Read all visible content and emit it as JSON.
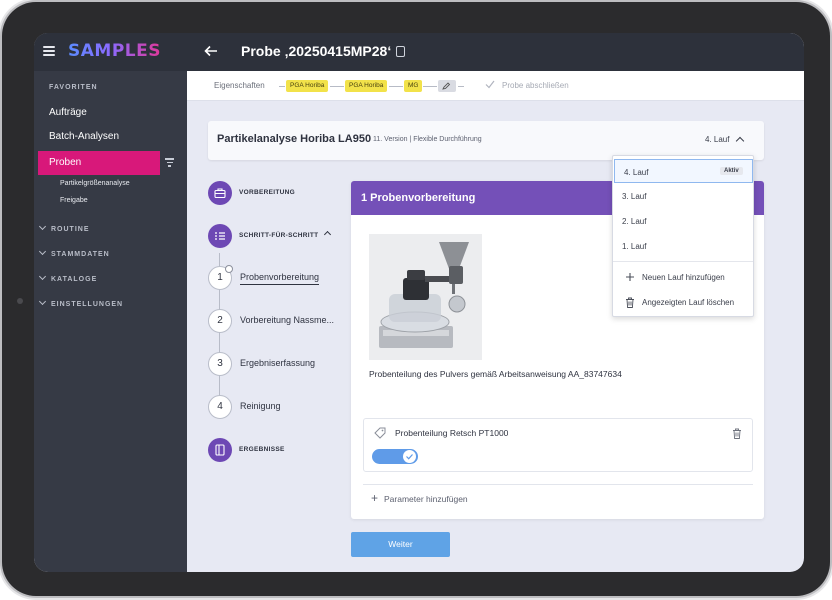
{
  "app": {
    "logo_text": "SAMPLES",
    "brand_color": "#d8187a",
    "accent_color": "#7450b8"
  },
  "header": {
    "title": "Probe ‚20250415MP28‘"
  },
  "sidebar": {
    "favorites_label": "FAVORITEN",
    "items": [
      {
        "label": "Aufträge"
      },
      {
        "label": "Batch-Analysen"
      },
      {
        "label": "Proben",
        "active": true
      }
    ],
    "subitems": [
      {
        "label": "Partikelgrößenanalyse"
      },
      {
        "label": "Freigabe"
      }
    ],
    "groups": [
      {
        "label": "ROUTINE"
      },
      {
        "label": "STAMMDATEN"
      },
      {
        "label": "KATALOGE"
      },
      {
        "label": "EINSTELLUNGEN"
      }
    ]
  },
  "workflow": {
    "properties_label": "Eigenschaften",
    "chips": [
      {
        "label": "PGA Horiba"
      },
      {
        "label": "PGA Horiba"
      },
      {
        "label": "MG"
      }
    ],
    "close_label": "Probe abschließen"
  },
  "method": {
    "title": "Partikelanalyse Horiba LA950",
    "subtitle": "11. Version | Flexible Durchführung",
    "run_selector": "4. Lauf"
  },
  "steps": {
    "preparation_label": "VORBEREITUNG",
    "stepwise_label": "SCHRITT-FÜR-SCHRITT",
    "items": [
      {
        "num": "1",
        "label": "Probenvorbereitung"
      },
      {
        "num": "2",
        "label": "Vorbereitung Nassme..."
      },
      {
        "num": "3",
        "label": "Ergebniserfassung"
      },
      {
        "num": "4",
        "label": "Reinigung"
      }
    ],
    "results_label": "ERGEBNISSE"
  },
  "card": {
    "title": "1  Probenvorbereitung",
    "caption": "Probenteilung des Pulvers gemäß Arbeitsanweisung AA_83747634",
    "parameter_label": "Probenteilung Retsch PT1000",
    "toggle_on": true,
    "add_parameter_label": "Parameter hinzufügen"
  },
  "continue_button": "Weiter",
  "runs_dropdown": {
    "items": [
      {
        "label": "4. Lauf",
        "badge": "Aktiv",
        "selected": true
      },
      {
        "label": "3. Lauf"
      },
      {
        "label": "2. Lauf"
      },
      {
        "label": "1. Lauf"
      }
    ],
    "add_label": "Neuen Lauf hinzufügen",
    "delete_label": "Angezeigten Lauf löschen"
  }
}
